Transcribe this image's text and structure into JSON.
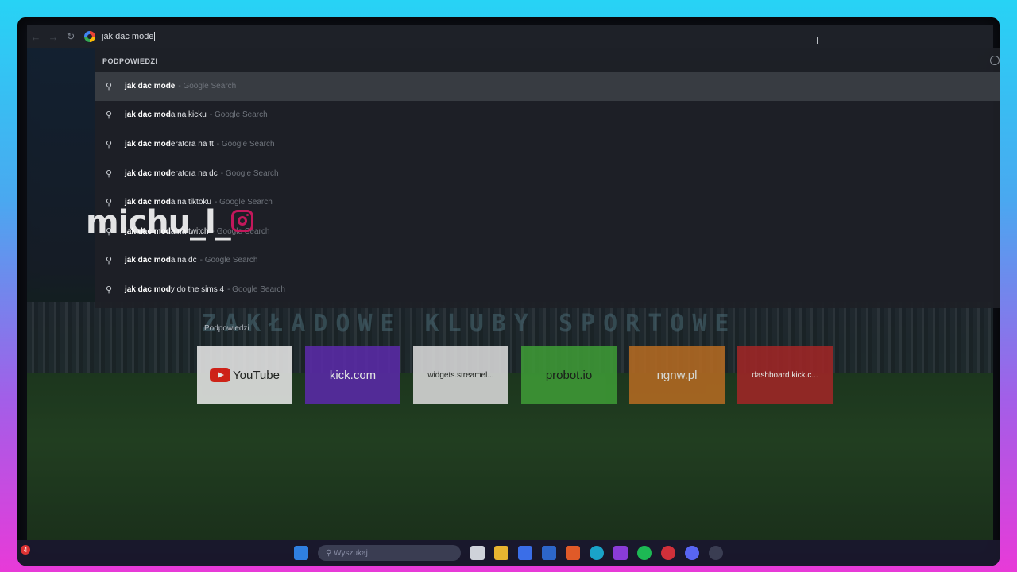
{
  "browser": {
    "omnibox_text": "jak dac mode",
    "back_icon": "arrow-left-icon",
    "forward_icon": "arrow-right-icon",
    "reload_icon": "reload-icon"
  },
  "dropdown": {
    "header": "PODPOWIEDZI",
    "suggestions": [
      {
        "bold": "jak dac mode",
        "rest": "",
        "engine": "- Google Search"
      },
      {
        "bold": "jak dac mod",
        "rest": "a na kicku",
        "engine": "- Google Search"
      },
      {
        "bold": "jak dac mod",
        "rest": "eratora na tt",
        "engine": "- Google Search"
      },
      {
        "bold": "jak dac mod",
        "rest": "eratora na dc",
        "engine": "- Google Search"
      },
      {
        "bold": "jak dac mod",
        "rest": "a na tiktoku",
        "engine": "- Google Search"
      },
      {
        "bold": "jak dac mod",
        "rest": "a na twitch",
        "engine": "- Google Search"
      },
      {
        "bold": "jak dac mod",
        "rest": "a na dc",
        "engine": "- Google Search"
      },
      {
        "bold": "jak dac mod",
        "rest": "y do the sims 4",
        "engine": "- Google Search"
      }
    ]
  },
  "watermark": {
    "text": "michu_l_"
  },
  "page": {
    "banner": "ZAKŁADOWE KLUBY SPORTOWE",
    "section_label": "Podpowiedzi",
    "speed_dials": [
      {
        "label": "YouTube"
      },
      {
        "label": "kick.com"
      },
      {
        "label": "widgets.streamel..."
      },
      {
        "label": "probot.io"
      },
      {
        "label": "ngnw.pl"
      },
      {
        "label": "dashboard.kick.c..."
      }
    ]
  },
  "taskbar": {
    "search_placeholder": "Wyszukaj",
    "notification_count": "4"
  },
  "colors": {
    "frame_top": "#27d3f5",
    "frame_bottom": "#e83ad8",
    "dropdown_bg": "#1e2026"
  }
}
